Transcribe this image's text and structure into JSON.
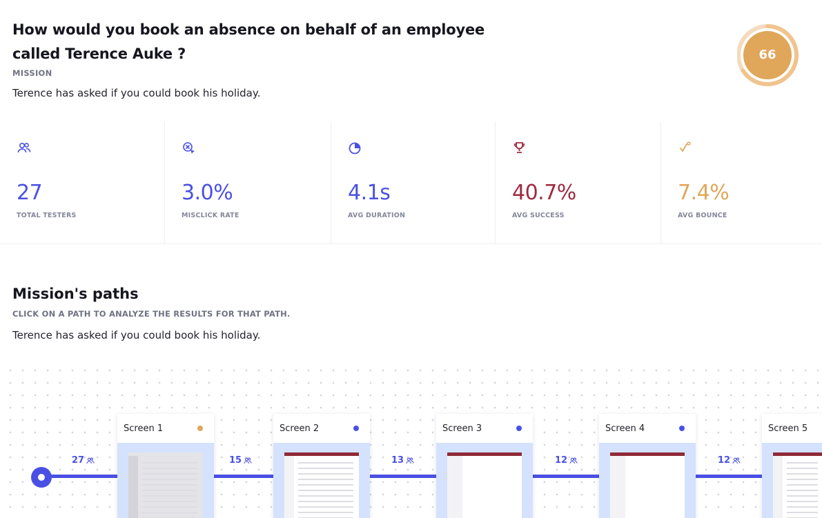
{
  "mission": {
    "title": "How would you book an absence on behalf of an employee called Terence Auke ?",
    "tag": "MISSION",
    "description": "Terence has asked if you could book his holiday."
  },
  "score": {
    "value": "66",
    "fraction": 0.66,
    "color": "#e0a65a",
    "track_color": "#f4dbbe"
  },
  "stats": [
    {
      "icon": "users-icon",
      "value": "27",
      "label": "TOTAL TESTERS",
      "color": "#4a50e3"
    },
    {
      "icon": "misclick-icon",
      "value": "3.0%",
      "label": "MISCLICK RATE",
      "color": "#4a50e3"
    },
    {
      "icon": "pie-clock-icon",
      "value": "4.1s",
      "label": "AVG DURATION",
      "color": "#4a50e3"
    },
    {
      "icon": "trophy-icon",
      "value": "40.7%",
      "label": "AVG SUCCESS",
      "color": "#9d2a3f"
    },
    {
      "icon": "bounce-icon",
      "value": "7.4%",
      "label": "AVG BOUNCE",
      "color": "#e0a65a"
    }
  ],
  "paths": {
    "title": "Mission's paths",
    "subtitle": "CLICK ON A PATH TO ANALYZE THE RESULTS FOR THAT PATH.",
    "description": "Terence has asked if you could book his holiday.",
    "counts": [
      "27",
      "15",
      "13",
      "12",
      "12"
    ],
    "screens": [
      {
        "name": "Screen 1",
        "dot_color": "#e0a65a"
      },
      {
        "name": "Screen 2",
        "dot_color": "#4a50e3"
      },
      {
        "name": "Screen 3",
        "dot_color": "#4a50e3"
      },
      {
        "name": "Screen 4",
        "dot_color": "#4a50e3"
      },
      {
        "name": "Screen 5",
        "dot_color": "#4a50e3"
      }
    ]
  }
}
